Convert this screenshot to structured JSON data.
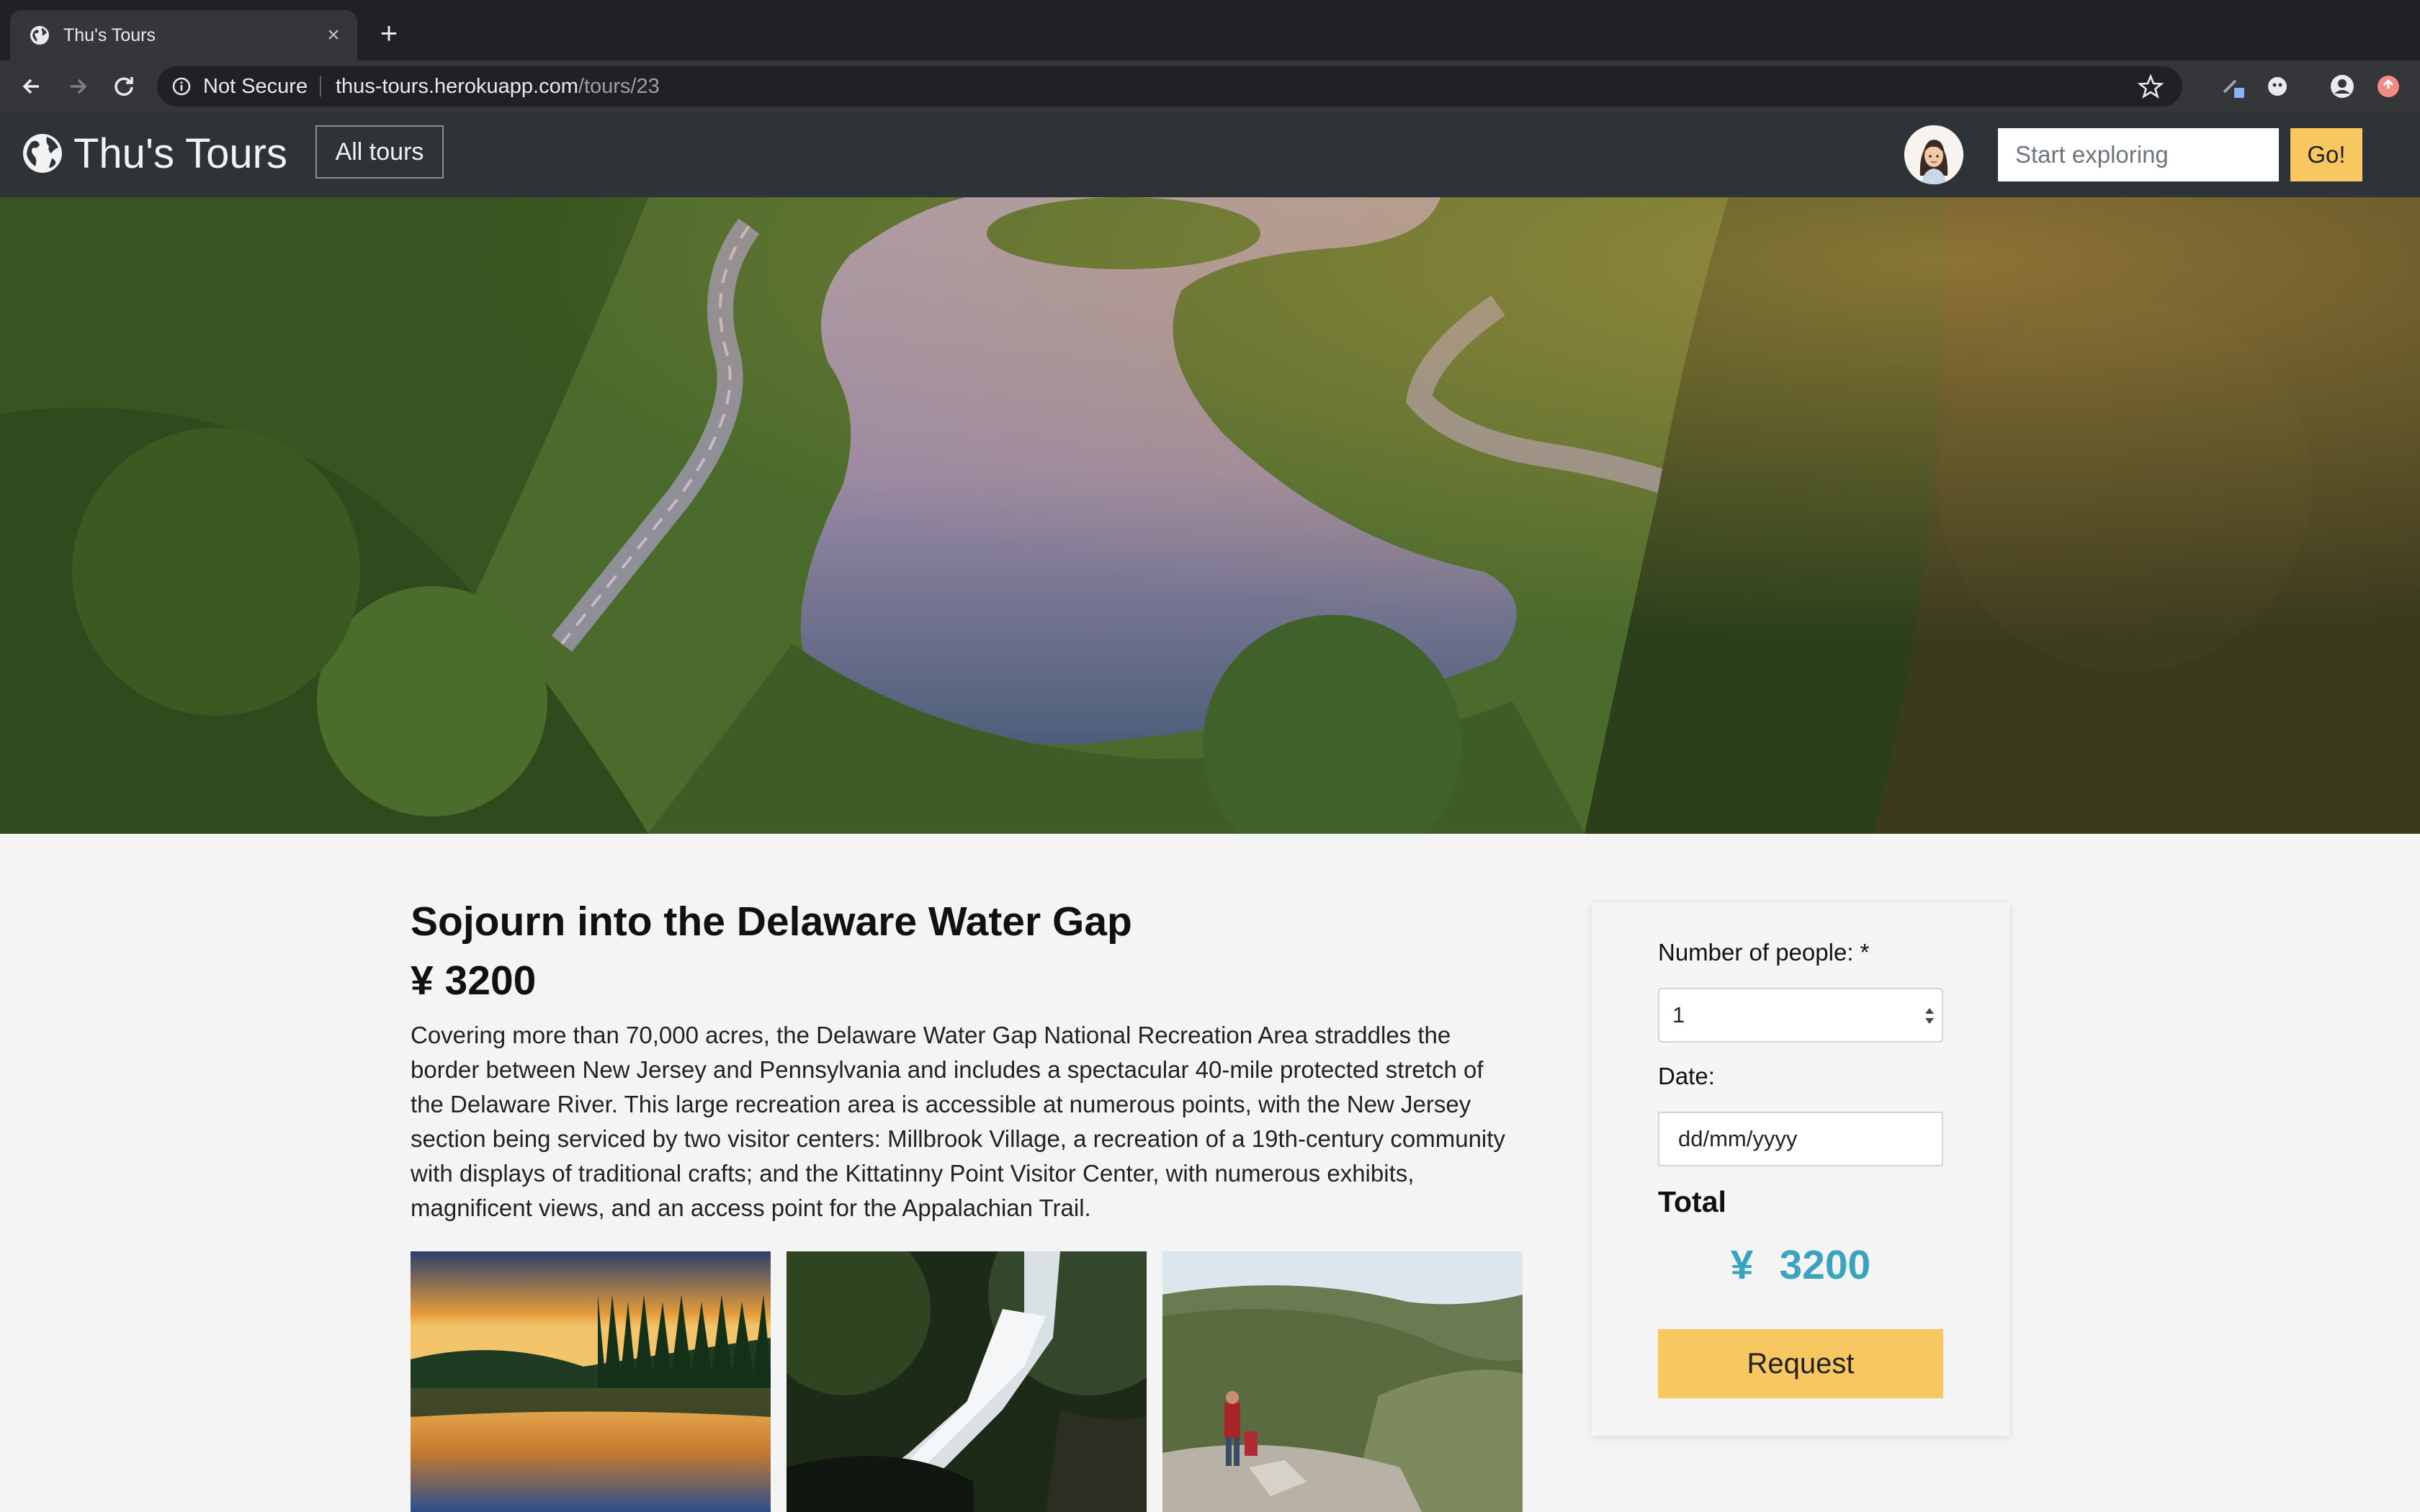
{
  "browser": {
    "tab_title": "Thu's Tours",
    "tab_close": "×",
    "new_tab": "+",
    "security_label": "Not Secure",
    "url_host": "thus-tours.herokuapp.com",
    "url_path": "/tours/23"
  },
  "navbar": {
    "brand": "Thu's Tours",
    "all_tours_label": "All tours",
    "search_placeholder": "Start exploring",
    "go_label": "Go!"
  },
  "tour": {
    "title": "Sojourn into the Delaware Water Gap",
    "price": "¥ 3200",
    "description": "Covering more than 70,000 acres, the Delaware Water Gap National Recreation Area straddles the border between New Jersey and Pennsylvania and includes a spectacular 40-mile protected stretch of the Delaware River. This large recreation area is accessible at numerous points, with the New Jersey section being serviced by two visitor centers: Millbrook Village, a recreation of a 19th-century community with displays of traditional crafts; and the Kittatinny Point Visitor Center, with numerous exhibits, magnificent views, and an access point for the Appalachian Trail."
  },
  "booking": {
    "people_label": "Number of people: *",
    "people_value": "1",
    "date_label": "Date:",
    "date_placeholder": "dd/mm/yyyy",
    "total_label": "Total",
    "total_currency": "¥",
    "total_amount": "3200",
    "request_label": "Request"
  },
  "colors": {
    "accent_yellow": "#f8c75f",
    "navbar_bg": "#2e3338",
    "total_teal": "#3aa3bd"
  }
}
